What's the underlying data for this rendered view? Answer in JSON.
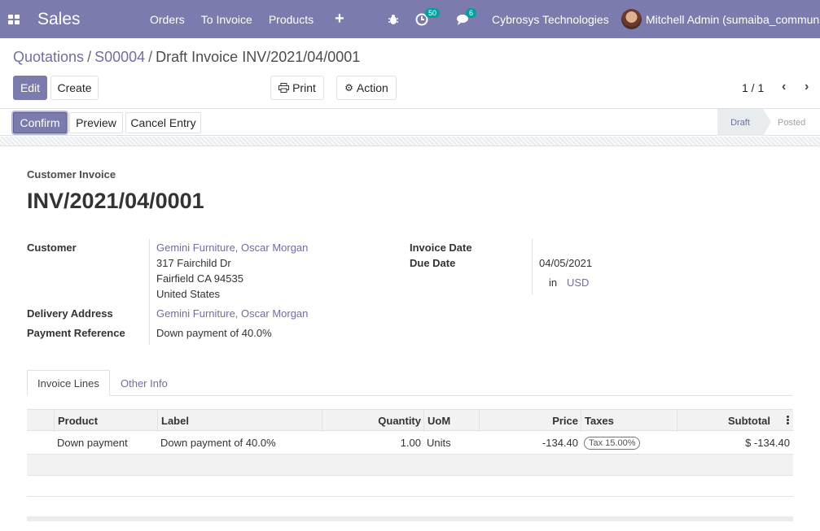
{
  "navbar": {
    "app_name": "Sales",
    "menu": [
      "Orders",
      "To Invoice",
      "Products"
    ],
    "plus": "+",
    "activity_count": "50",
    "messages_count": "6",
    "company": "Cybrosys Technologies",
    "user": "Mitchell Admin (sumaiba_community)"
  },
  "breadcrumb": {
    "items": [
      "Quotations",
      "S00004"
    ],
    "current": "Draft Invoice INV/2021/04/0001"
  },
  "control": {
    "edit": "Edit",
    "create": "Create",
    "print": "Print",
    "action": "Action",
    "pager": "1 / 1"
  },
  "statusbar": {
    "confirm": "Confirm",
    "preview": "Preview",
    "cancel_entry": "Cancel Entry",
    "stages": [
      "Draft",
      "Posted"
    ],
    "active_stage": "Draft"
  },
  "invoice": {
    "type_label": "Customer Invoice",
    "name": "INV/2021/04/0001",
    "customer_label": "Customer",
    "customer": "Gemini Furniture, Oscar Morgan",
    "address": [
      "317 Fairchild Dr",
      "Fairfield CA 94535",
      "United States"
    ],
    "delivery_label": "Delivery Address",
    "delivery": "Gemini Furniture, Oscar Morgan",
    "payment_ref_label": "Payment Reference",
    "payment_ref": "Down payment of 40.0%",
    "invoice_date_label": "Invoice Date",
    "due_date_label": "Due Date",
    "due_date": "04/05/2021",
    "currency_prefix": "in",
    "currency": "USD"
  },
  "tabs": [
    "Invoice Lines",
    "Other Info"
  ],
  "lines": {
    "headers": [
      "Product",
      "Label",
      "Quantity",
      "UoM",
      "Price",
      "Taxes",
      "Subtotal"
    ],
    "rows": [
      {
        "product": "Down payment",
        "label": "Down payment of 40.0%",
        "quantity": "1.00",
        "uom": "Units",
        "price": "-134.40",
        "tax": "Tax 15.00%",
        "subtotal": "$ -134.40"
      }
    ]
  }
}
